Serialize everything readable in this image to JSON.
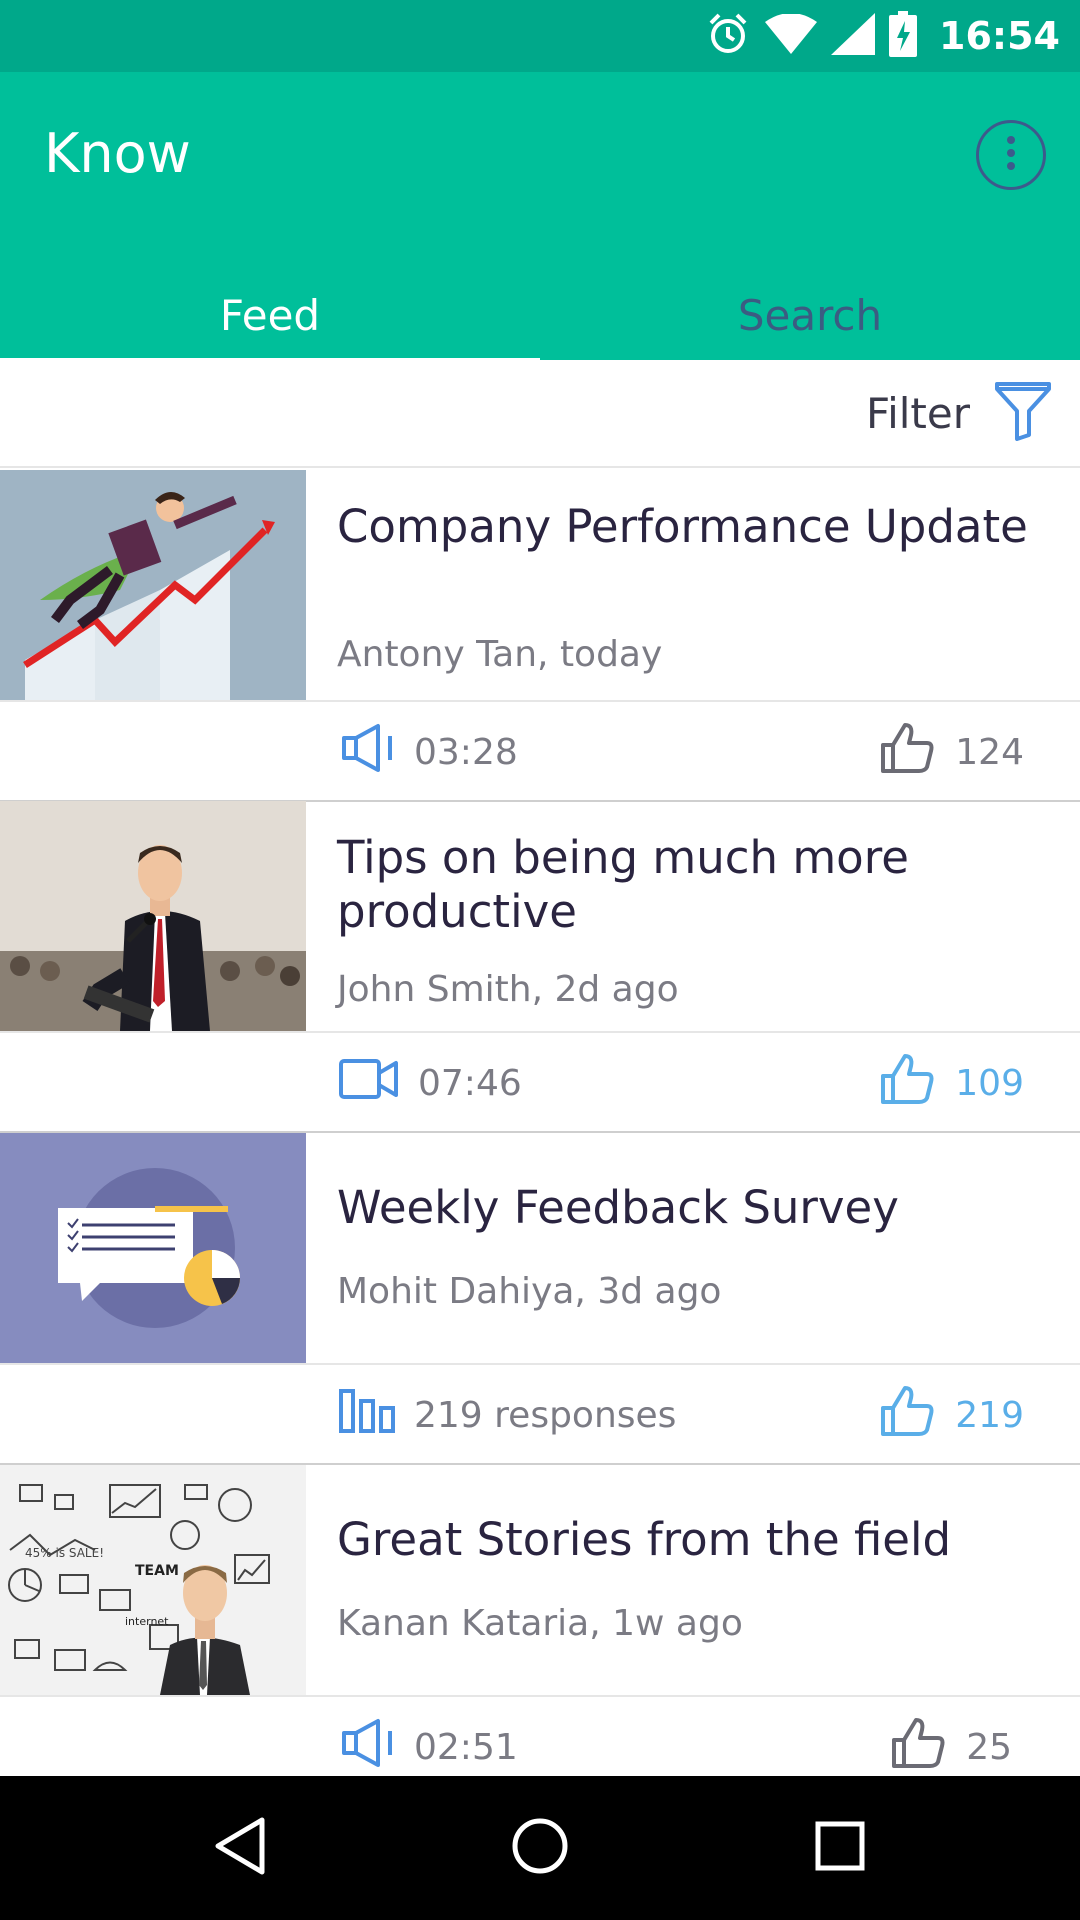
{
  "status_bar": {
    "time": "16:54",
    "icons": [
      "alarm-icon",
      "wifi-icon",
      "signal-icon",
      "battery-charging-icon"
    ]
  },
  "app_bar": {
    "title": "Know",
    "menu_icon": "more-vert-icon"
  },
  "tabs": [
    {
      "label": "Feed",
      "active": true
    },
    {
      "label": "Search",
      "active": false
    }
  ],
  "filter": {
    "label": "Filter",
    "icon": "funnel-icon"
  },
  "feed": [
    {
      "title": "Company Performance Update",
      "meta": "Antony Tan, today",
      "type_icon": "speaker-icon",
      "stat": "03:28",
      "likes": "124",
      "liked": false
    },
    {
      "title": "Tips on being much more productive",
      "meta": "John Smith, 2d ago",
      "type_icon": "video-camera-icon",
      "stat": "07:46",
      "likes": "109",
      "liked": true
    },
    {
      "title": "Weekly Feedback Survey",
      "meta": "Mohit Dahiya, 3d ago",
      "type_icon": "bar-chart-icon",
      "stat": "219 responses",
      "likes": "219",
      "liked": true
    },
    {
      "title": "Great Stories from the field",
      "meta": "Kanan Kataria, 1w ago",
      "type_icon": "speaker-icon",
      "stat": "02:51",
      "likes": "25",
      "liked": false
    }
  ],
  "nav_bar": {
    "buttons": [
      "back-icon",
      "home-icon",
      "recents-icon"
    ]
  },
  "colors": {
    "primary": "#00bf9a",
    "status_bar": "#00a88a",
    "accent_blue": "#4a90e2",
    "liked_blue": "#5aaee8",
    "inactive_tab": "#3b5c82"
  }
}
